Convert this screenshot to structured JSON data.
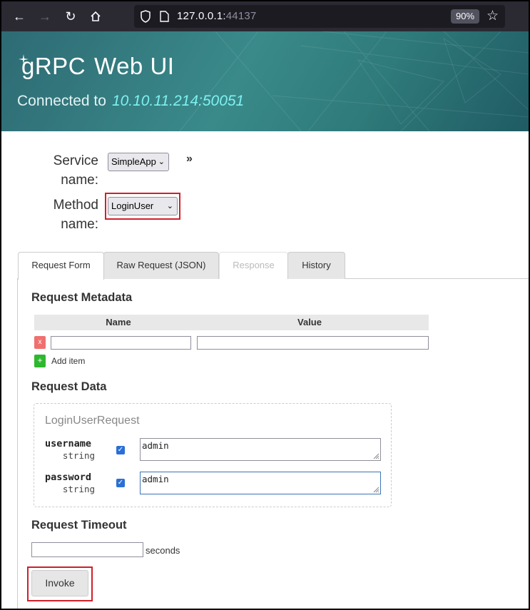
{
  "browser": {
    "url_host": "127.0.0.1:",
    "url_port": "44137",
    "zoom": "90%"
  },
  "header": {
    "brand_grpc": "gRPC",
    "brand_webui": "Web UI",
    "connected_label": "Connected to",
    "connected_address": "10.10.11.214:50051"
  },
  "selectors": {
    "service_label_line1": "Service",
    "service_label_line2": "name:",
    "service_value": "SimpleApp",
    "method_label_line1": "Method",
    "method_label_line2": "name:",
    "method_value": "LoginUser",
    "expand_glyph": "»"
  },
  "tabs": [
    {
      "label": "Request Form",
      "state": "active"
    },
    {
      "label": "Raw Request (JSON)",
      "state": "normal"
    },
    {
      "label": "Response",
      "state": "disabled"
    },
    {
      "label": "History",
      "state": "normal"
    }
  ],
  "metadata": {
    "heading": "Request Metadata",
    "col_name": "Name",
    "col_value": "Value",
    "delete_label": "x",
    "add_label": "Add item",
    "add_glyph": "+"
  },
  "request_data": {
    "heading": "Request Data",
    "message_type": "LoginUserRequest",
    "fields": [
      {
        "name": "username",
        "type": "string",
        "value": "admin",
        "checked": true
      },
      {
        "name": "password",
        "type": "string",
        "value": "admin",
        "checked": true
      }
    ]
  },
  "timeout": {
    "heading": "Request Timeout",
    "value": "",
    "unit_label": "seconds"
  },
  "invoke_label": "Invoke",
  "colors": {
    "highlight": "#d0202a",
    "banner": "#3a8a8a",
    "address": "#7ff0f0"
  }
}
